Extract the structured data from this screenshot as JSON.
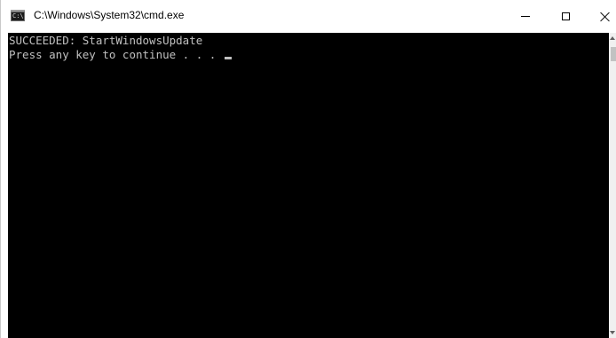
{
  "window": {
    "title": "C:\\Windows\\System32\\cmd.exe",
    "icon": "cmd-console-icon",
    "icon_text": "C:\\",
    "controls": {
      "minimize_icon": "minimize-icon",
      "maximize_icon": "maximize-icon",
      "close_icon": "close-icon"
    }
  },
  "console": {
    "background": "#000000",
    "foreground": "#c0c0c0",
    "lines": [
      "SUCCEEDED: StartWindowsUpdate",
      "Press any key to continue . . . "
    ]
  }
}
